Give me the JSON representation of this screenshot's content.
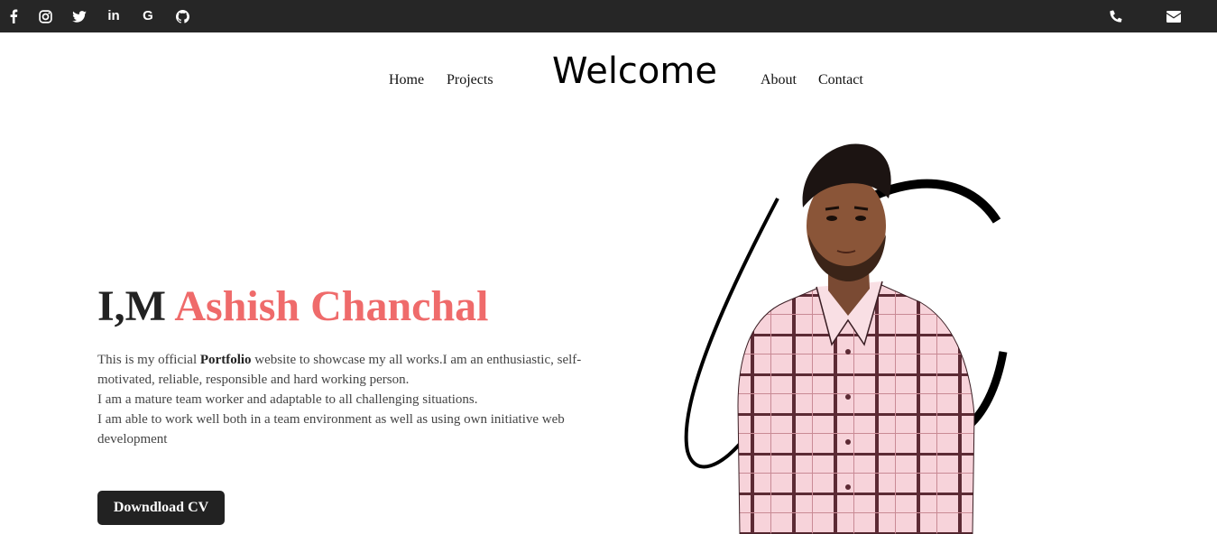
{
  "topbar": {
    "social_icons": [
      "facebook-icon",
      "instagram-icon",
      "twitter-icon",
      "linkedin-icon",
      "google-icon",
      "github-icon"
    ],
    "linkedin_text": "in",
    "google_text": "G",
    "contact_icons": [
      "phone-icon",
      "envelope-icon"
    ]
  },
  "nav": {
    "home": "Home",
    "projects": "Projects",
    "brand": "Welcome",
    "about": "About",
    "contact": "Contact"
  },
  "hero": {
    "prefix": "I,M",
    "name": "Ashish Chanchal",
    "bio_1_before": "This is my official ",
    "bio_1_bold": "Portfolio",
    "bio_1_after": " website to showcase my all works.I am an enthusiastic, self-motivated, reliable, responsible and hard working person.",
    "bio_2": "I am a mature team worker and adaptable to all challenging situations.",
    "bio_3": "I am able to work well both in a team environment as well as using own initiative web development",
    "cv_button": "Downdload CV"
  },
  "colors": {
    "topbar": "#262626",
    "accent": "#ef6b6b",
    "button": "#222222"
  }
}
